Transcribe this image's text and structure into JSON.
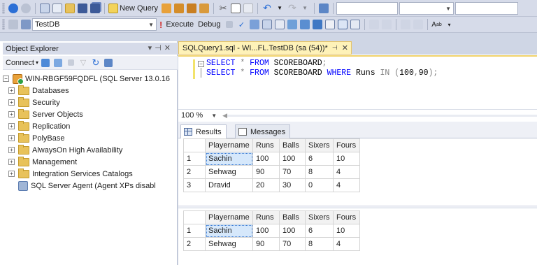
{
  "toolbar1": {
    "new_query_label": "New Query"
  },
  "toolbar2": {
    "database_selected": "TestDB",
    "execute_label": "Execute",
    "debug_label": "Debug"
  },
  "object_explorer": {
    "title": "Object Explorer",
    "connect_label": "Connect",
    "server_node": "WIN-RBGF59FQDFL (SQL Server 13.0.16",
    "folders": [
      {
        "label": "Databases"
      },
      {
        "label": "Security"
      },
      {
        "label": "Server Objects"
      },
      {
        "label": "Replication"
      },
      {
        "label": "PolyBase"
      },
      {
        "label": "AlwaysOn High Availability"
      },
      {
        "label": "Management"
      },
      {
        "label": "Integration Services Catalogs"
      }
    ],
    "agent_node": "SQL Server Agent (Agent XPs disabl"
  },
  "editor": {
    "tab_title": "SQLQuery1.sql - WI...FL.TestDB (sa (54))*",
    "line1": {
      "kw1": "SELECT",
      "star": "*",
      "kw2": "FROM",
      "table": "SCOREBOARD",
      "end": ";"
    },
    "line2": {
      "kw1": "SELECT",
      "star": "*",
      "kw2": "FROM",
      "table": "SCOREBOARD",
      "kw3": "WHERE",
      "col": "Runs",
      "kw4": "IN",
      "open": "(",
      "v1": "100",
      "comma": ",",
      "v2": "90",
      "close": ");"
    },
    "zoom": "100 %"
  },
  "results": {
    "tab_results": "Results",
    "tab_messages": "Messages",
    "columns": [
      "Playername",
      "Runs",
      "Balls",
      "Sixers",
      "Fours"
    ],
    "grid1": [
      {
        "n": "1",
        "Playername": "Sachin",
        "Runs": "100",
        "Balls": "100",
        "Sixers": "6",
        "Fours": "10"
      },
      {
        "n": "2",
        "Playername": "Sehwag",
        "Runs": "90",
        "Balls": "70",
        "Sixers": "8",
        "Fours": "4"
      },
      {
        "n": "3",
        "Playername": "Dravid",
        "Runs": "20",
        "Balls": "30",
        "Sixers": "0",
        "Fours": "4"
      }
    ],
    "grid2": [
      {
        "n": "1",
        "Playername": "Sachin",
        "Runs": "100",
        "Balls": "100",
        "Sixers": "6",
        "Fours": "10"
      },
      {
        "n": "2",
        "Playername": "Sehwag",
        "Runs": "90",
        "Balls": "70",
        "Sixers": "8",
        "Fours": "4"
      }
    ]
  }
}
